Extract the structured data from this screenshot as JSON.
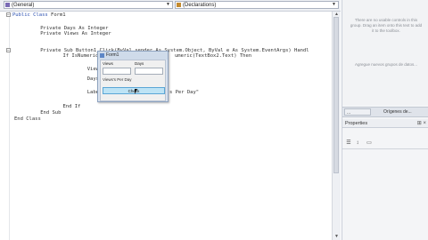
{
  "toolbar": {
    "left_combo": "(General)",
    "right_combo": "(Declarations)"
  },
  "code": {
    "lines": [
      "Public Class Form1",
      "    Private Days As Integer",
      "    Private Views As Integer",
      "    Private Sub Button1_Click(ByVal sender As System.Object, ByVal e As System.EventArgs) Handl",
      "        If IsNumeric(Text",
      "            Views = Text",
      "            Days = TextB",
      "            Label3.Text",
      "        End If",
      "    End Sub",
      "End Class"
    ],
    "line4_hidden_fragment": "umeric(TextBox2.Text) Then",
    "line7_fragment": "s Per Day\""
  },
  "form": {
    "title": "Form1",
    "label_views": "Views",
    "label_days": "Days",
    "label_result": "Views's Per Day",
    "button": "Check"
  },
  "toolbox": {
    "message1": "There are no usable controls in this group. Drag an item onto this text to add it to the toolbox.",
    "message2": "Agregue nuevos grupos de datos..."
  },
  "right_tabs": {
    "tab1": "...",
    "tab2": "Orígenes de..."
  },
  "properties": {
    "title": "Properties"
  }
}
